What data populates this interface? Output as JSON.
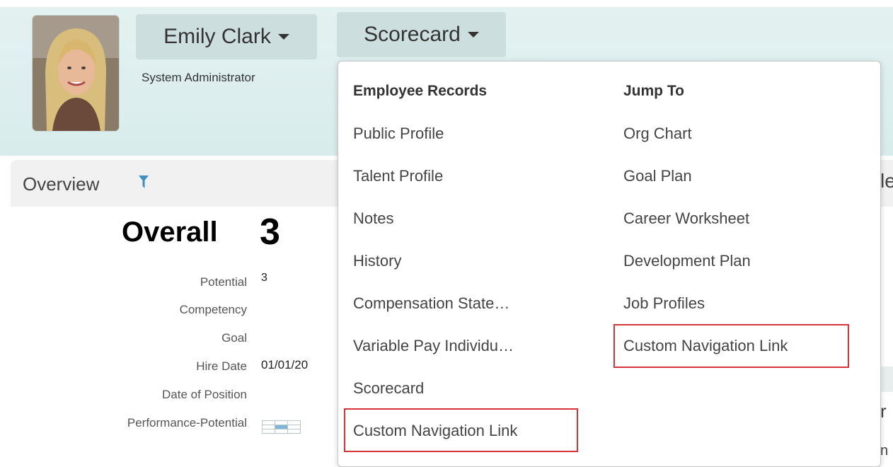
{
  "user": {
    "name": "Emily Clark",
    "role": "System Administrator"
  },
  "nav": {
    "scorecard_label": "Scorecard"
  },
  "overview": {
    "title": "Overview",
    "overall_label": "Overall",
    "overall_value": "3",
    "fields": [
      {
        "label": "Potential",
        "value": "3"
      },
      {
        "label": "Competency",
        "value": ""
      },
      {
        "label": "Goal",
        "value": ""
      },
      {
        "label": "Hire Date",
        "value": "01/01/20"
      },
      {
        "label": "Date of Position",
        "value": ""
      },
      {
        "label": "Performance-Potential",
        "value": ""
      }
    ],
    "clipped_right_text": "le",
    "clipped_right_text2": "r",
    "clipped_right_text3": "n"
  },
  "dropdown": {
    "col1_heading": "Employee Records",
    "col1_items": [
      "Public Profile",
      "Talent Profile",
      "Notes",
      "History",
      "Compensation State…",
      "Variable Pay Individu…",
      "Scorecard",
      "Custom Navigation Link"
    ],
    "col2_heading": "Jump To",
    "col2_items": [
      "Org Chart",
      "Goal Plan",
      "Career Worksheet",
      "Development Plan",
      "Job Profiles",
      "Custom Navigation Link"
    ]
  },
  "colors": {
    "header_bg": "#e0efef",
    "button_bg": "#cddede",
    "highlight": "#d8323b",
    "filter_icon": "#3d8fc4"
  },
  "icons": [
    "caret-down-icon",
    "filter-icon"
  ]
}
